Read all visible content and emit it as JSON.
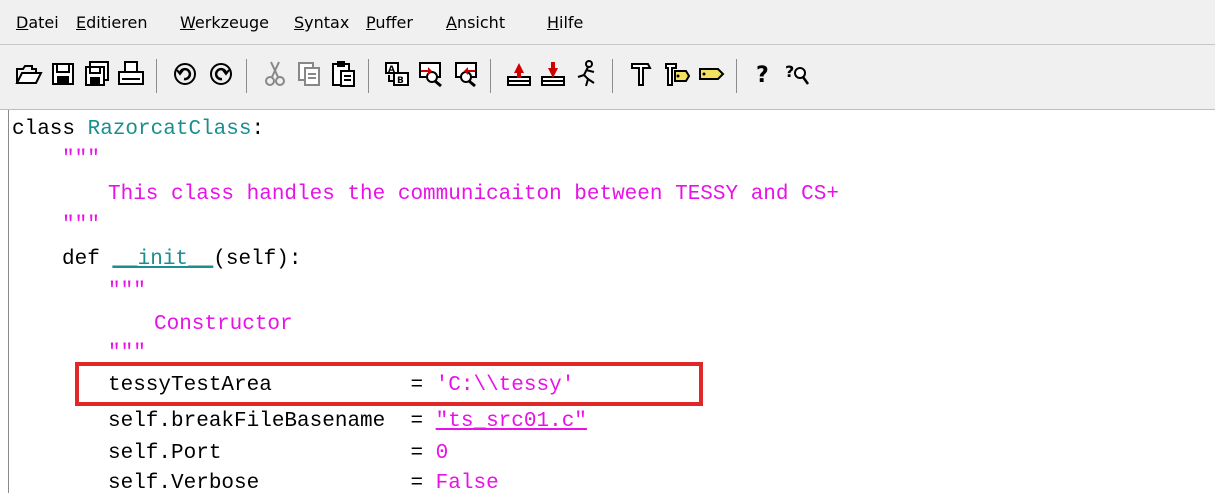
{
  "menu": {
    "items": [
      {
        "acc": "D",
        "rest": "atei"
      },
      {
        "acc": "E",
        "rest": "ditieren"
      },
      {
        "acc": "W",
        "rest": "erkzeuge"
      },
      {
        "acc": "S",
        "rest": "yntax"
      },
      {
        "acc": "P",
        "rest": "uffer"
      },
      {
        "acc": "A",
        "rest": "nsicht"
      },
      {
        "acc": "H",
        "rest": "ilfe"
      }
    ]
  },
  "toolbar": {
    "icons": [
      "open-icon",
      "save-icon",
      "save-all-icon",
      "print-icon",
      "undo-icon",
      "redo-icon",
      "cut-icon",
      "copy-icon",
      "paste-icon",
      "find-replace-icon",
      "find-next-icon",
      "find-prev-icon",
      "load-session-icon",
      "save-session-icon",
      "run-script-icon",
      "make-icon",
      "build-tags-icon",
      "jump-tag-icon",
      "help-icon",
      "help-find-icon"
    ]
  },
  "code": {
    "line1": {
      "kw": "class",
      "name": "RazorcatClass",
      "colon": ":"
    },
    "line2": "\"\"\"",
    "line3": "This class handles the communicaiton between TESSY and CS+",
    "line4": "\"\"\"",
    "line5": {
      "kw": "def",
      "space": " ",
      "fn": "__init__",
      "args": "(self):"
    },
    "line6": "\"\"\"",
    "line7": "Constructor",
    "line8": "\"\"\"",
    "line9": {
      "lhs": "tessyTestArea           ",
      "op": "= ",
      "val": "'C:\\\\tessy'"
    },
    "line10": {
      "lhs": "self.breakFileBasename  ",
      "op": "= ",
      "val": "\"ts_src01.c\""
    },
    "line11": {
      "lhs": "self.Port               ",
      "op": "= ",
      "val": "0"
    },
    "line12": {
      "lhs": "self.Verbose            ",
      "op": "= ",
      "val": "False"
    }
  },
  "colors": {
    "class_name": "#1a8f8f",
    "string": "#e812e8",
    "highlight_box": "#e02828"
  }
}
